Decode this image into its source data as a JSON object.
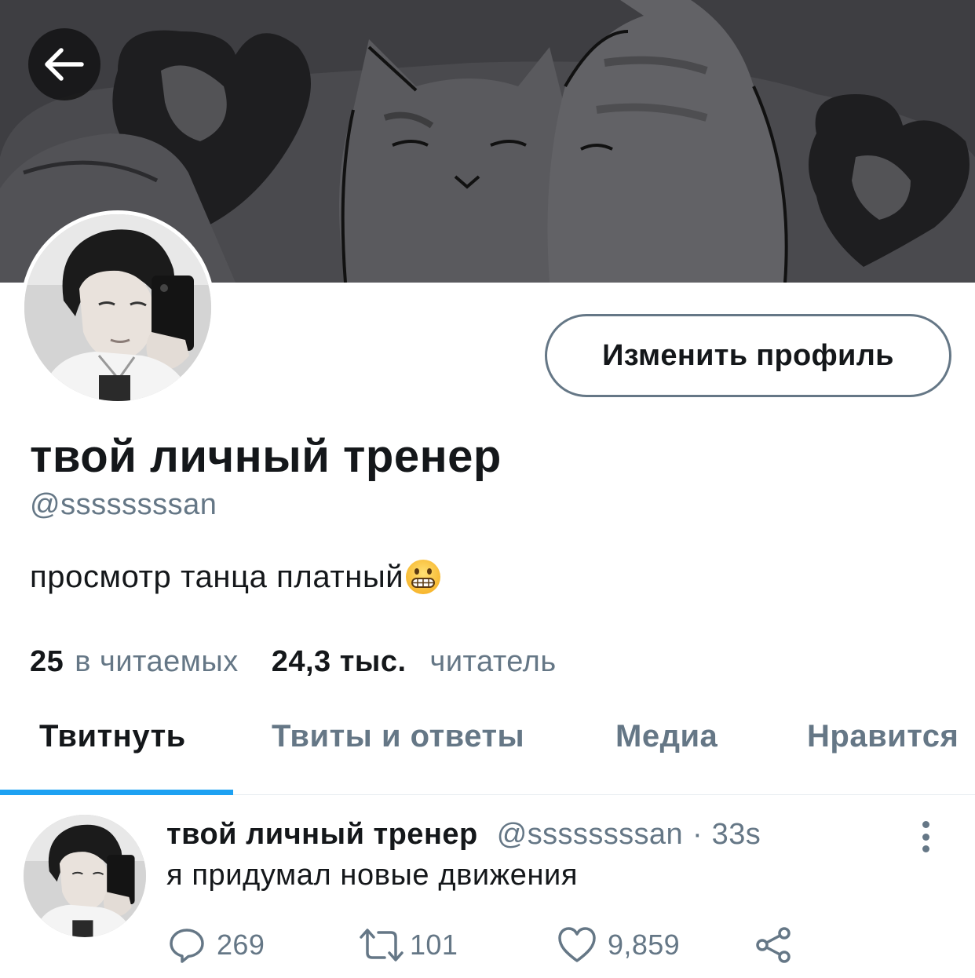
{
  "nav": {
    "back_icon": "arrow-left-icon"
  },
  "profile": {
    "display_name": "твой личный тренер",
    "handle": "@ssssssssan",
    "bio": "просмотр танца платный",
    "bio_emoji": "grimacing-face-emoji",
    "edit_button_label": "Изменить профиль",
    "following_count": "25",
    "following_label": "в читаемых",
    "followers_count": "24,3 тыс.",
    "followers_label": "читатель"
  },
  "tabs": [
    {
      "label": "Твитнуть",
      "active": true
    },
    {
      "label": "Твиты и ответы",
      "active": false
    },
    {
      "label": "Медиа",
      "active": false
    },
    {
      "label": "Нравится",
      "active": false
    }
  ],
  "tweet": {
    "author_name": "твой личный тренер",
    "author_handle": "@ssssssssan",
    "separator": "·",
    "time": "33s",
    "text": "я придумал новые движения",
    "reply_count": "269",
    "retweet_count": "101",
    "like_count": "9,859",
    "icons": [
      "reply-icon",
      "retweet-icon",
      "like-icon",
      "share-icon",
      "more-vertical-icon"
    ]
  },
  "colors": {
    "primary_text": "#14171a",
    "secondary_text": "#657786",
    "accent": "#1da1f2",
    "banner": "#3d3d40"
  }
}
